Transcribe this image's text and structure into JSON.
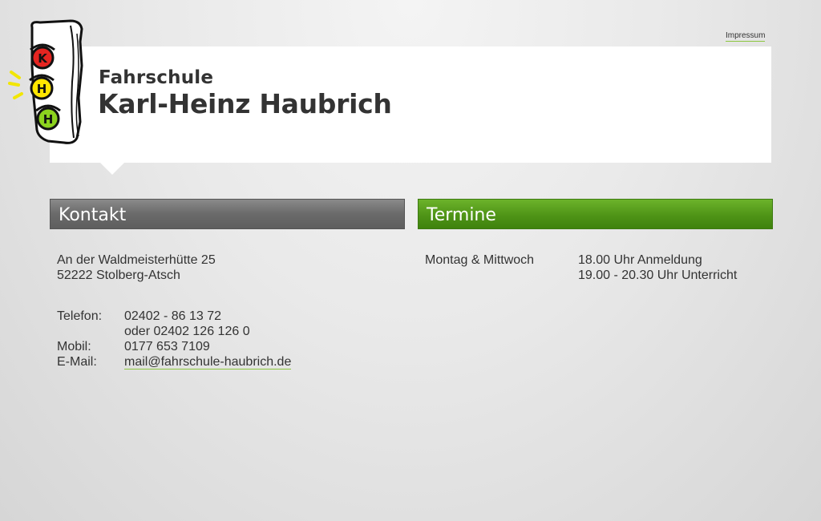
{
  "top_links": {
    "impressum": "Impressum"
  },
  "header": {
    "title_small": "Fahrschule",
    "title_big": "Karl-Heinz Haubrich",
    "logo_letters": [
      "K",
      "H",
      "H"
    ],
    "logo_colors": {
      "red": "#e52521",
      "yellow": "#ffe600",
      "green": "#8cd21e"
    }
  },
  "kontakt": {
    "heading": "Kontakt",
    "address_line1": "An der Waldmeisterhütte 25",
    "address_line2": "52222 Stolberg-Atsch",
    "telefon_label": "Telefon:",
    "telefon_value1": "02402 - 86 13 72",
    "telefon_value2": "oder 02402 126 126 0",
    "mobil_label": "Mobil:",
    "mobil_value": "0177 653 7109",
    "email_label": "E-Mail:",
    "email_value": "mail@fahrschule-haubrich.de"
  },
  "termine": {
    "heading": "Termine",
    "days": "Montag & Mittwoch",
    "time1": "18.00 Uhr Anmeldung",
    "time2": "19.00 - 20.30 Uhr Unterricht"
  },
  "colors": {
    "accent_green": "#4f9417",
    "bar_gray": "#6a6a6a",
    "link_underline": "#8cc63f"
  }
}
